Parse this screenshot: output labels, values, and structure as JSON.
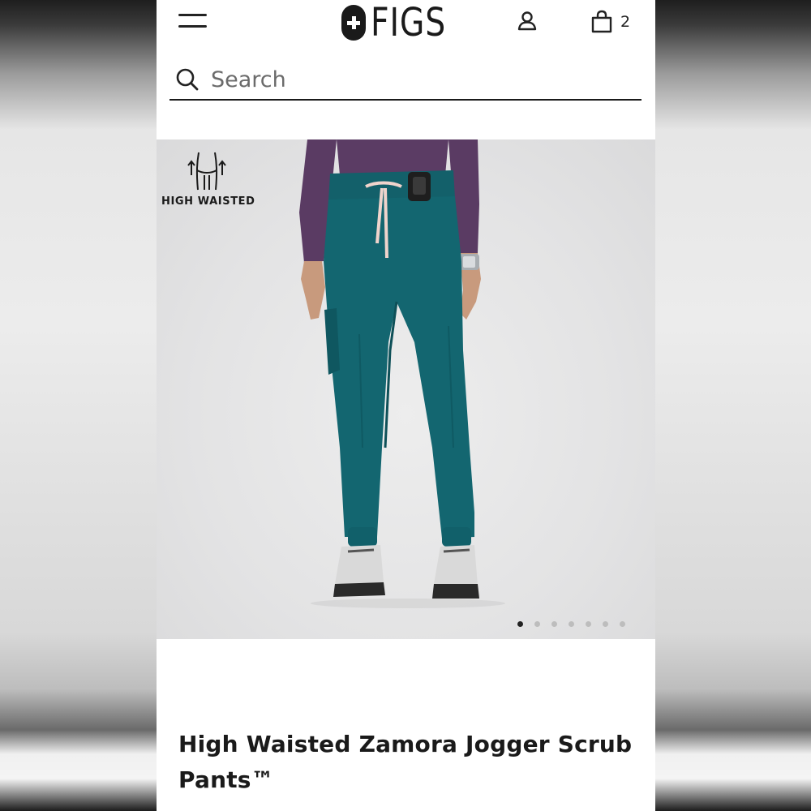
{
  "header": {
    "brand": "FIGS",
    "cart_count": "2",
    "menu_icon": "hamburger-menu-icon",
    "account_icon": "user-account-icon",
    "cart_icon": "shopping-bag-icon"
  },
  "search": {
    "placeholder": "Search",
    "value": ""
  },
  "product": {
    "feature_badge": "HIGH WAISTED",
    "feature_icon": "high-waist-icon",
    "title": "High Waisted Zamora Jogger Scrub Pants™",
    "image_count": 7,
    "active_image": 1,
    "pants_color": "#136670",
    "top_color": "#5a3b63"
  }
}
